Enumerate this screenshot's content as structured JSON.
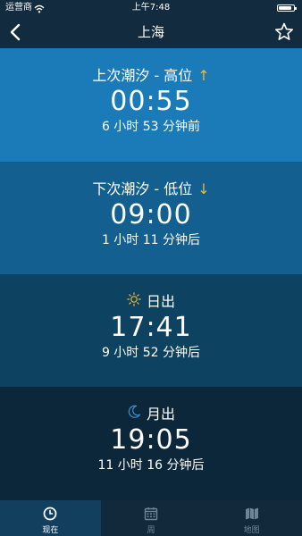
{
  "status_bar": {
    "carrier": "运营商",
    "time": "上午7:48"
  },
  "nav": {
    "title": "上海"
  },
  "sections": [
    {
      "label": "上次潮汐 - 高位",
      "arrow": "↑",
      "time": "00:55",
      "relative": "6 小时 53 分钟前"
    },
    {
      "label": "下次潮汐 - 低位",
      "arrow": "↓",
      "time": "09:00",
      "relative": "1 小时 11 分钟后"
    },
    {
      "label": "日出",
      "icon": "sun-icon",
      "time": "17:41",
      "relative": "9 小时 52 分钟后"
    },
    {
      "label": "月出",
      "icon": "moon-icon",
      "time": "19:05",
      "relative": "11 小时 16 分钟后"
    }
  ],
  "tabs": [
    {
      "label": "现在",
      "icon": "clock-icon",
      "active": true
    },
    {
      "label": "周",
      "icon": "calendar-icon",
      "active": false
    },
    {
      "label": "地图",
      "icon": "map-icon",
      "active": false
    }
  ],
  "colors": {
    "arrow": "#f2b632",
    "section_1": "#1a7bb8",
    "section_2": "#125f90",
    "section_3": "#0d4261",
    "section_4": "#0c2739"
  }
}
